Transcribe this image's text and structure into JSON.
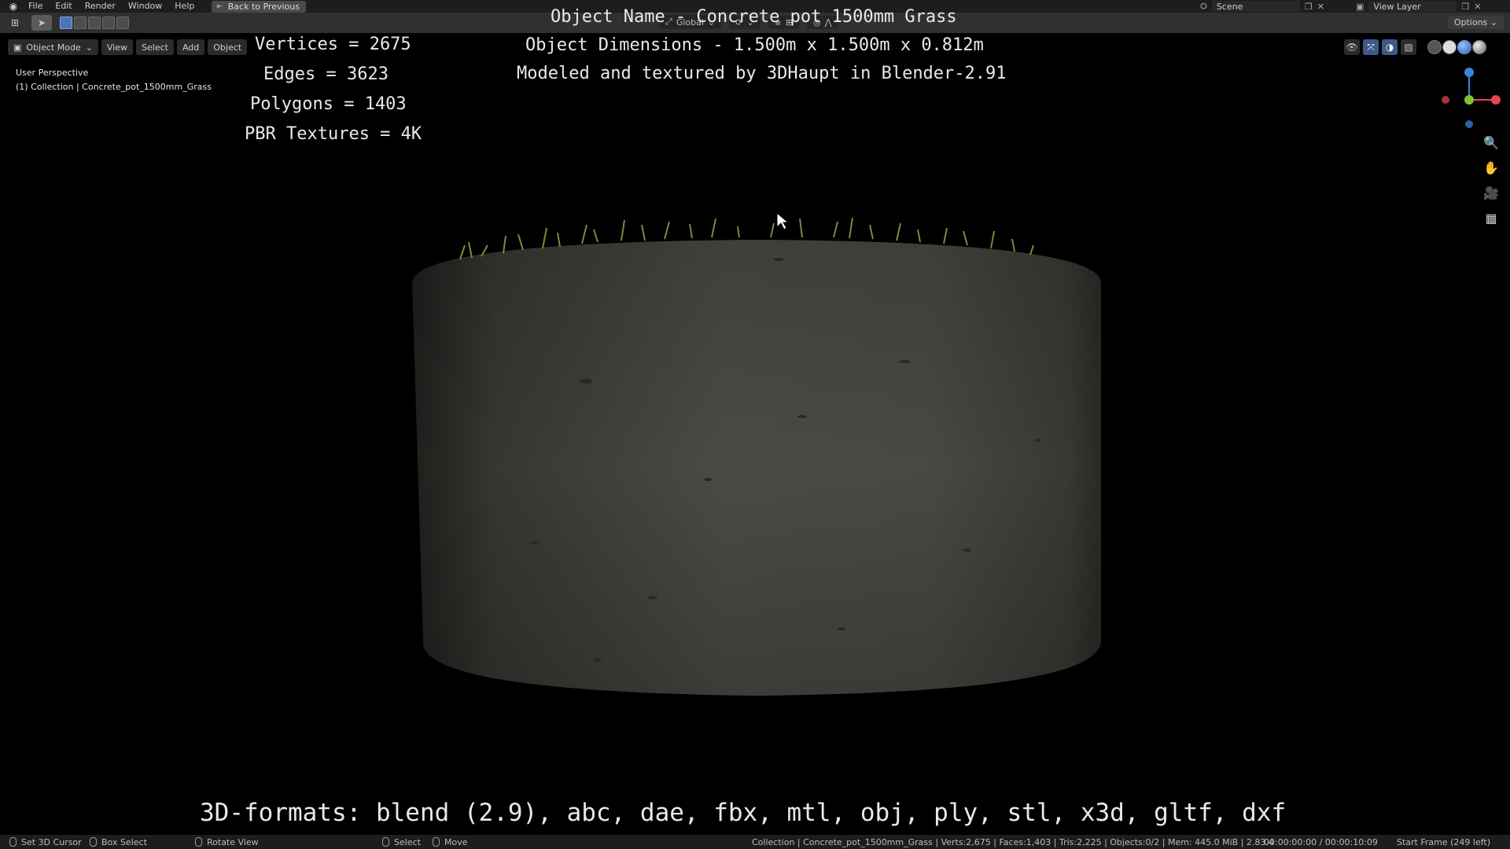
{
  "menu": {
    "items": [
      "File",
      "Edit",
      "Render",
      "Window",
      "Help"
    ],
    "back_button": "Back to Previous",
    "scene_label": "Scene",
    "view_layer_label": "View Layer"
  },
  "toolheader": {
    "transform_orientation": "Global",
    "options_label": "Options"
  },
  "viewport_header": {
    "mode": "Object Mode",
    "view": "View",
    "select": "Select",
    "add": "Add",
    "object": "Object"
  },
  "viewport": {
    "perspective": "User Perspective",
    "collection": "(1) Collection | Concrete_pot_1500mm_Grass"
  },
  "overlay": {
    "object_name": "Object Name - Concrete pot 1500mm Grass",
    "dimensions": "Object Dimensions -  1.500m x 1.500m x 0.812m",
    "modeled_by": "Modeled and textured by 3DHaupt in Blender-2.91",
    "vertices": "Vertices = 2675",
    "edges": "Edges = 3623",
    "polygons": "Polygons = 1403",
    "pbr": "PBR Textures = 4K",
    "formats": "3D-formats: blend (2.9), abc, dae, fbx, mtl, obj, ply, stl, x3d, gltf, dxf"
  },
  "statusbar": {
    "set_cursor": "Set 3D Cursor",
    "box_select": "Box Select",
    "rotate_view": "Rotate View",
    "select": "Select",
    "move": "Move",
    "stats": "Collection | Concrete_pot_1500mm_Grass | Verts:2,675 | Faces:1,403 | Tris:2,225 | Objects:0/2 | Mem: 445.0 MiB | 2.83.4",
    "time": "00:00:00:00 / 00:00:10:09",
    "frame": "Start Frame (249 left)"
  },
  "colors": {
    "background": "#000000",
    "concrete": "#4a4843",
    "grass": "#7c8a3a",
    "axis_x": "#e8434f",
    "axis_y": "#7fc035",
    "axis_z": "#3b83d9"
  }
}
